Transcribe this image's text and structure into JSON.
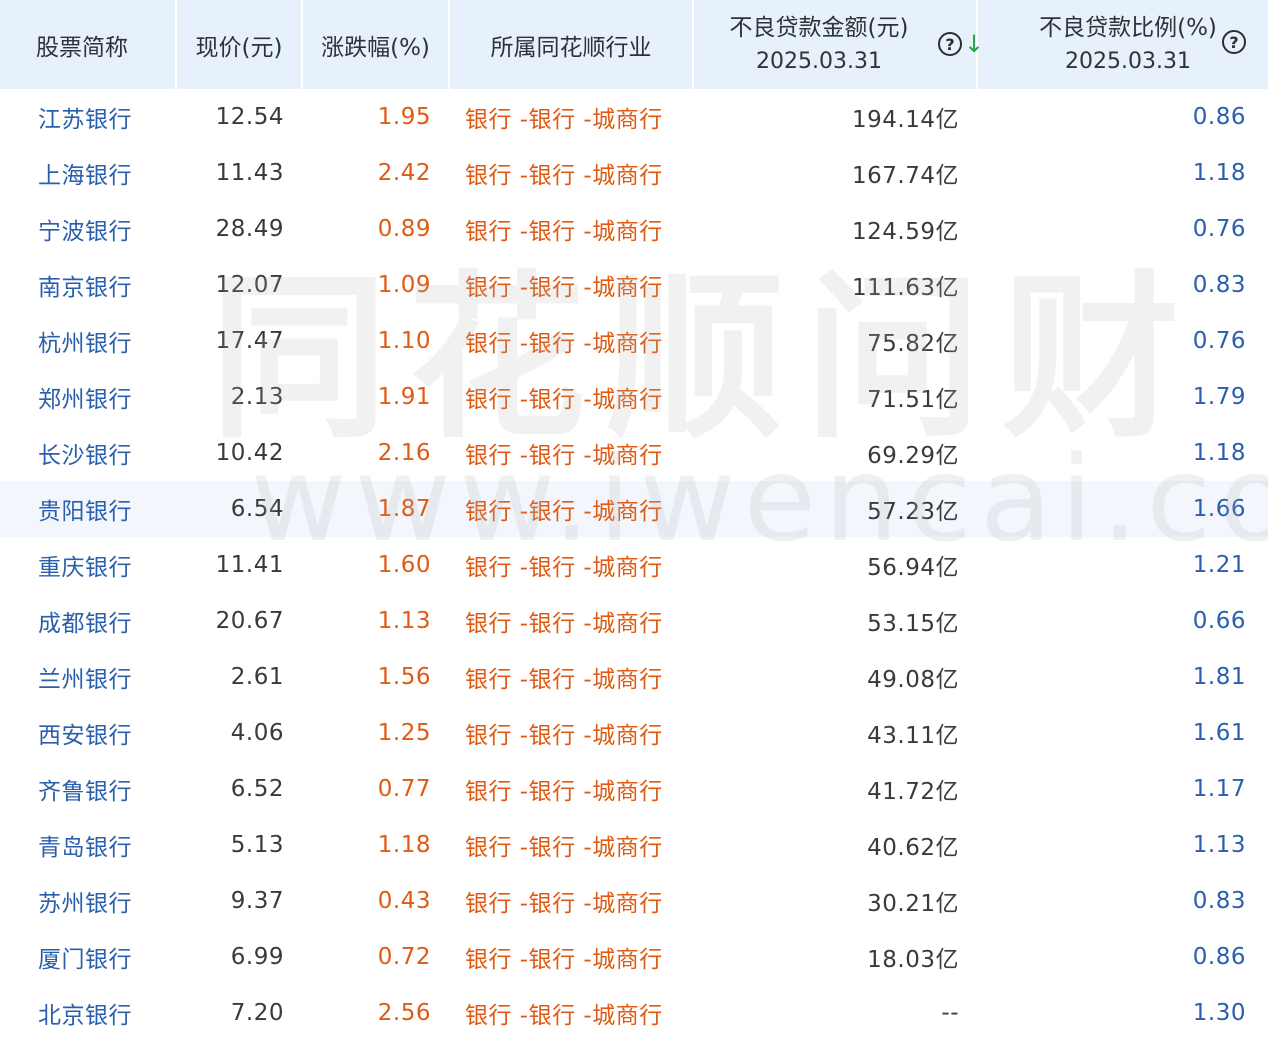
{
  "headers": {
    "name": "股票简称",
    "price": "现价(元)",
    "change": "涨跌幅(%)",
    "industry": "所属同花顺行业",
    "npl_amount": "不良贷款金额(元)",
    "npl_amount_date": "2025.03.31",
    "npl_ratio": "不良贷款比例(%)",
    "npl_ratio_date": "2025.03.31",
    "help_icon": "?",
    "sort_icon": "↓"
  },
  "rows": [
    {
      "name": "江苏银行",
      "price": "12.54",
      "change": "1.95",
      "industry": "银行 -银行 -城商行",
      "npl": "194.14亿",
      "ratio": "0.86"
    },
    {
      "name": "上海银行",
      "price": "11.43",
      "change": "2.42",
      "industry": "银行 -银行 -城商行",
      "npl": "167.74亿",
      "ratio": "1.18"
    },
    {
      "name": "宁波银行",
      "price": "28.49",
      "change": "0.89",
      "industry": "银行 -银行 -城商行",
      "npl": "124.59亿",
      "ratio": "0.76"
    },
    {
      "name": "南京银行",
      "price": "12.07",
      "change": "1.09",
      "industry": "银行 -银行 -城商行",
      "npl": "111.63亿",
      "ratio": "0.83"
    },
    {
      "name": "杭州银行",
      "price": "17.47",
      "change": "1.10",
      "industry": "银行 -银行 -城商行",
      "npl": "75.82亿",
      "ratio": "0.76"
    },
    {
      "name": "郑州银行",
      "price": "2.13",
      "change": "1.91",
      "industry": "银行 -银行 -城商行",
      "npl": "71.51亿",
      "ratio": "1.79"
    },
    {
      "name": "长沙银行",
      "price": "10.42",
      "change": "2.16",
      "industry": "银行 -银行 -城商行",
      "npl": "69.29亿",
      "ratio": "1.18"
    },
    {
      "name": "贵阳银行",
      "price": "6.54",
      "change": "1.87",
      "industry": "银行 -银行 -城商行",
      "npl": "57.23亿",
      "ratio": "1.66"
    },
    {
      "name": "重庆银行",
      "price": "11.41",
      "change": "1.60",
      "industry": "银行 -银行 -城商行",
      "npl": "56.94亿",
      "ratio": "1.21"
    },
    {
      "name": "成都银行",
      "price": "20.67",
      "change": "1.13",
      "industry": "银行 -银行 -城商行",
      "npl": "53.15亿",
      "ratio": "0.66"
    },
    {
      "name": "兰州银行",
      "price": "2.61",
      "change": "1.56",
      "industry": "银行 -银行 -城商行",
      "npl": "49.08亿",
      "ratio": "1.81"
    },
    {
      "name": "西安银行",
      "price": "4.06",
      "change": "1.25",
      "industry": "银行 -银行 -城商行",
      "npl": "43.11亿",
      "ratio": "1.61"
    },
    {
      "name": "齐鲁银行",
      "price": "6.52",
      "change": "0.77",
      "industry": "银行 -银行 -城商行",
      "npl": "41.72亿",
      "ratio": "1.17"
    },
    {
      "name": "青岛银行",
      "price": "5.13",
      "change": "1.18",
      "industry": "银行 -银行 -城商行",
      "npl": "40.62亿",
      "ratio": "1.13"
    },
    {
      "name": "苏州银行",
      "price": "9.37",
      "change": "0.43",
      "industry": "银行 -银行 -城商行",
      "npl": "30.21亿",
      "ratio": "0.83"
    },
    {
      "name": "厦门银行",
      "price": "6.99",
      "change": "0.72",
      "industry": "银行 -银行 -城商行",
      "npl": "18.03亿",
      "ratio": "0.86"
    },
    {
      "name": "北京银行",
      "price": "7.20",
      "change": "2.56",
      "industry": "银行 -银行 -城商行",
      "npl": "--",
      "ratio": "1.30"
    }
  ],
  "highlight_row_index": 7,
  "watermark": {
    "cn": "同花顺问财",
    "url": "www.iwencai.com"
  },
  "colors": {
    "header_bg": "#e6f1fb",
    "name_link": "#2a5fad",
    "change_up": "#e05a12",
    "sort_arrow": "#2aa44a",
    "row_highlight": "#f3f7fd"
  }
}
